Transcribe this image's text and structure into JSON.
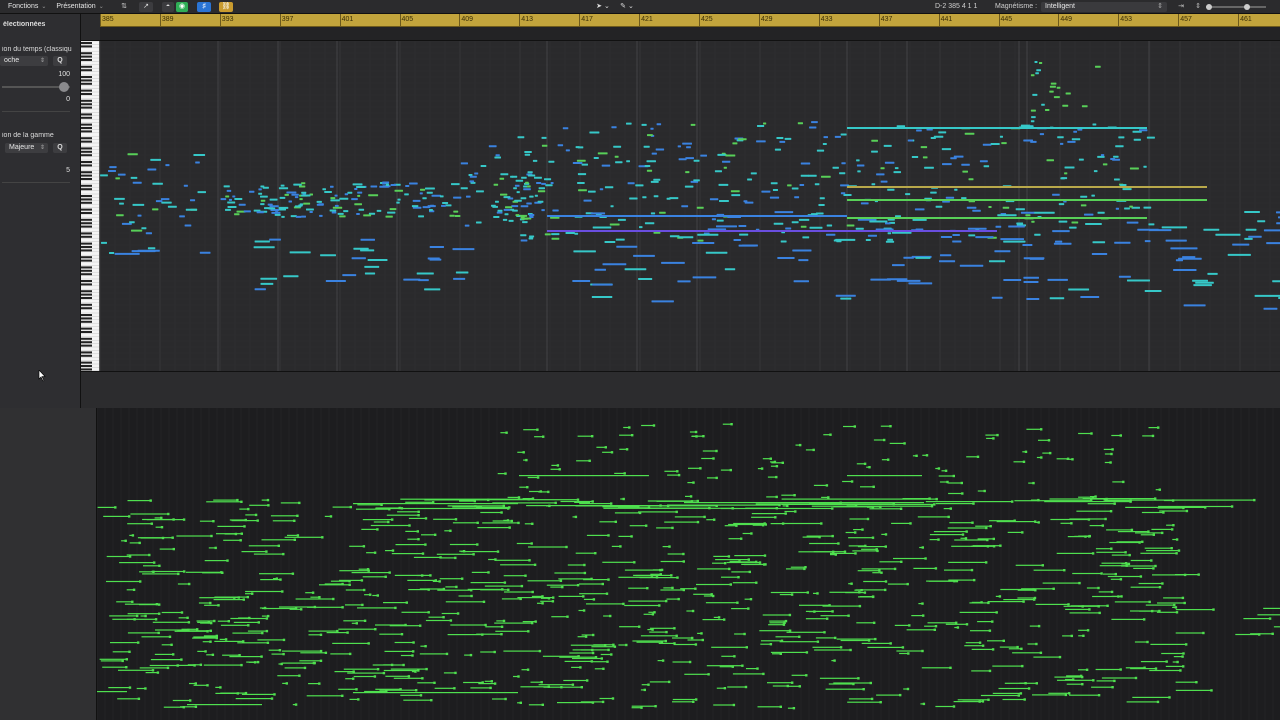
{
  "menubar": {
    "menus": [
      {
        "label": "Fonctions"
      },
      {
        "label": "Présentation"
      }
    ],
    "position_readout": "D-2  385 4 1 1",
    "magnet_label": "Magnétisme :",
    "magnet_value": "Intelligent"
  },
  "inspector": {
    "header": "électionnées",
    "time_quantize_label": "ion du temps (classiqu",
    "time_quantize_value": "oche",
    "quantize_button": "Q",
    "strength_value": "100",
    "swing_value": "0",
    "scale_quantize_label": "ion de la gamme",
    "scale_value": "Majeure",
    "scale_q_button": "Q",
    "scale_offset_value": "5"
  },
  "ruler": {
    "bars": [
      "385",
      "389",
      "393",
      "397",
      "401",
      "405",
      "409",
      "413",
      "417",
      "421",
      "425",
      "429",
      "433",
      "437",
      "441",
      "445",
      "449",
      "453",
      "457",
      "461"
    ]
  },
  "colors": {
    "ruler": "#c2a43c",
    "roll_bg": "#2a2a2c",
    "note_cyan": "#36c8c8",
    "note_blue": "#3a82e0",
    "note_green": "#58d058",
    "note_purple": "#6a4ee0",
    "lower_note": "#4fe04f"
  }
}
